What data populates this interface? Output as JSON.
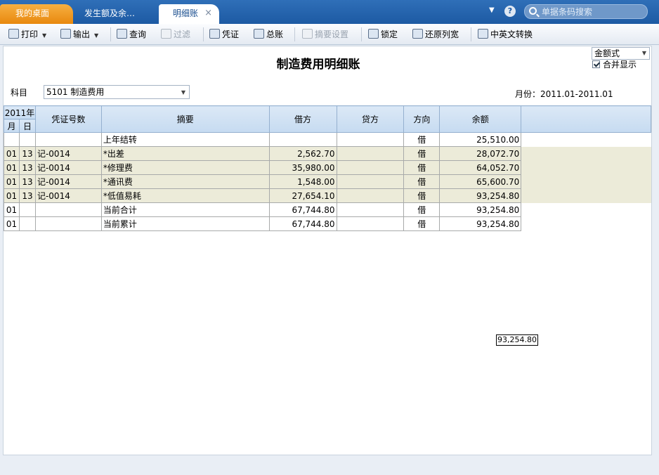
{
  "tabs": [
    {
      "label": "我的桌面"
    },
    {
      "label": "发生额及余…"
    },
    {
      "label": "明细账"
    }
  ],
  "tab_close": "×",
  "search": {
    "placeholder": "单据条码搜索"
  },
  "toolbar": {
    "print": "打印",
    "export": "输出",
    "query": "查询",
    "filter": "过滤",
    "voucher": "凭证",
    "general_ledger": "总账",
    "summary_settings": "摘要设置",
    "lock": "锁定",
    "restore_width": "还原列宽",
    "cn_en_switch": "中英文转换"
  },
  "page": {
    "title": "制造费用明细账",
    "format_select": "金额式",
    "merge_label": "合并显示",
    "subject_label": "科目",
    "subject_value": "5101 制造费用",
    "period": "月份：2011.01-2011.01"
  },
  "table": {
    "year_header": "2011年",
    "headers": {
      "month": "月",
      "day": "日",
      "voucher_no": "凭证号数",
      "summary": "摘要",
      "debit": "借方",
      "credit": "贷方",
      "direction": "方向",
      "balance": "余额"
    },
    "rows": [
      {
        "month": "",
        "day": "",
        "voucher": "",
        "summary": "上年结转",
        "debit": "",
        "credit": "",
        "direction": "借",
        "balance": "25,510.00"
      },
      {
        "month": "01",
        "day": "13",
        "voucher": "记-0014",
        "summary": "*出差",
        "debit": "2,562.70",
        "credit": "",
        "direction": "借",
        "balance": "28,072.70"
      },
      {
        "month": "01",
        "day": "13",
        "voucher": "记-0014",
        "summary": "*修理费",
        "debit": "35,980.00",
        "credit": "",
        "direction": "借",
        "balance": "64,052.70"
      },
      {
        "month": "01",
        "day": "13",
        "voucher": "记-0014",
        "summary": "*通讯费",
        "debit": "1,548.00",
        "credit": "",
        "direction": "借",
        "balance": "65,600.70"
      },
      {
        "month": "01",
        "day": "13",
        "voucher": "记-0014",
        "summary": "*低值易耗",
        "debit": "27,654.10",
        "credit": "",
        "direction": "借",
        "balance": "93,254.80"
      },
      {
        "month": "01",
        "day": "",
        "voucher": "",
        "summary": "当前合计",
        "debit": "67,744.80",
        "credit": "",
        "direction": "借",
        "balance": "93,254.80"
      },
      {
        "month": "01",
        "day": "",
        "voucher": "",
        "summary": "当前累计",
        "debit": "67,744.80",
        "credit": "",
        "direction": "借",
        "balance": "93,254.80"
      }
    ]
  },
  "tooltip": "93,254.80"
}
